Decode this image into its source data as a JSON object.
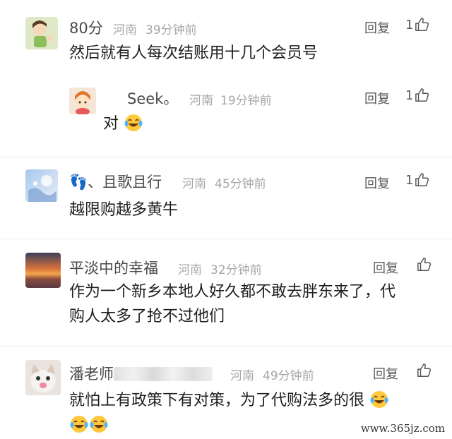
{
  "comments": [
    {
      "name": "80分",
      "location": "河南",
      "time": "39分钟前",
      "reply": "回复",
      "likes": "1",
      "lines": [
        "然后就有人每次结账用十几个会员号"
      ]
    },
    {
      "name": "Seek。",
      "location": "河南",
      "time": "19分钟前",
      "reply": "回复",
      "likes": "1",
      "lines": [
        "对"
      ]
    },
    {
      "name": "、且歌且行",
      "location": "河南",
      "time": "45分钟前",
      "reply": "回复",
      "likes": "1",
      "lines": [
        "越限购越多黄牛"
      ]
    },
    {
      "name": "平淡中的幸福",
      "location": "河南",
      "time": "32分钟前",
      "reply": "回复",
      "likes": "",
      "lines": [
        "作为一个新乡本地人好久都不敢去胖东来了，代",
        "购人太多了抢不过他们"
      ]
    },
    {
      "name": "潘老师",
      "location": "河南",
      "time": "49分钟前",
      "reply": "回复",
      "likes": "",
      "lines": [
        "就怕上有政策下有对策，为了代购法多的很"
      ]
    }
  ],
  "icons": {
    "like": "thumbs-up-icon",
    "emoji": "laughing-tears-emoji",
    "footprint": "footprints-icon"
  },
  "colors": {
    "name": "#4a4a4a",
    "meta": "#a6a6a6",
    "text": "#1e1e1e"
  },
  "watermark": "www.365jz.com"
}
